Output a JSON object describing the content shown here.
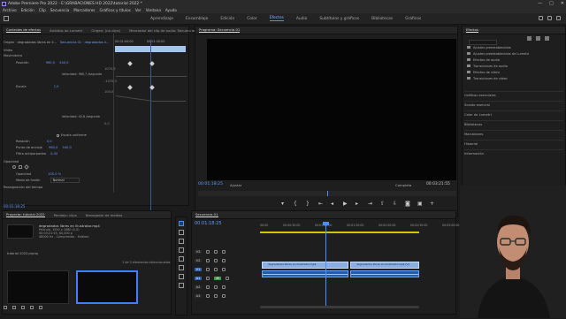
{
  "app": {
    "title": "Adobe Premiere Pro 2022 - E:\\GRABACIONES HD 2022\\tutorial 2022 *",
    "window_controls": [
      "—",
      "□",
      "✕"
    ]
  },
  "menu": [
    "Archivo",
    "Edición",
    "Clip",
    "Secuencia",
    "Marcadores",
    "Gráficos y títulos",
    "Ver",
    "Ventana",
    "Ayuda"
  ],
  "workspace": {
    "tabs": [
      "Aprendizaje",
      "Ensamblaje",
      "Edición",
      "Color",
      "Efectos",
      "Audio",
      "Subtítulos y gráficos",
      "Bibliotecas",
      "Gráficos"
    ],
    "active": "Efectos"
  },
  "effect_controls": {
    "tabs": [
      "Controles de efectos",
      "Ámbitos de Lumetri",
      "Origen: (no clips)",
      "Mezclador del clip de audio: Secuencia"
    ],
    "source": "Origen · degradados libres en il...",
    "sequence": "Secuencia 01 · degradados li...",
    "ruler_start": "00:01:00:00",
    "ruler_mid": "00:01:30:00",
    "section_video": "Vídeo",
    "props": {
      "movimiento": "Movimiento",
      "posicion_label": "Posición",
      "posicion_x": "960,0",
      "posicion_y": "540,0",
      "vel1_label": "Velocidad: 960,7 /segundo",
      "escala_label": "Escala",
      "escala_val": "1,0",
      "vel2_label": "Velocidad: 42,8 /segundo",
      "escala_uniforme": "Escala uniforme",
      "rotacion_label": "Rotación",
      "rotacion_val": "0,0",
      "anclaje_label": "Punto de anclaje",
      "anclaje_x": "960,0",
      "anclaje_y": "540,0",
      "antiparpadeo_label": "Filtro antiparpadeo",
      "antiparpadeo_val": "0,00",
      "opacidad": "Opacidad",
      "opacidad_label": "Opacidad",
      "opacidad_val": "100,0 %",
      "fusion_label": "Modo de fusión",
      "fusion_val": "Normal",
      "reasignacion": "Reasignación del tiempo",
      "graph_top": "100,0",
      "graph_bottom": "0,0",
      "graph_v1": "1070,3",
      "graph_v2": "-1070,3"
    },
    "timecode": "00:01:18:25"
  },
  "program": {
    "tab": "Programa: Secuencia 01",
    "timecode": "00:01:18:25",
    "fit": "Ajustar",
    "resolution": "Completa",
    "duration": "00:03:21:55",
    "controls": [
      "marker",
      "in",
      "out",
      "go-in",
      "step-back",
      "play",
      "step-fwd",
      "go-out",
      "insert",
      "overwrite",
      "export-frame",
      "compare",
      "add"
    ]
  },
  "effects_panel": {
    "tab": "Efectos",
    "folders": [
      "Ajustes preestablecidos",
      "Ajustes preestablecidos de Lumetri",
      "Efectos de audio",
      "Transiciones de audio",
      "Efectos de vídeo",
      "Transiciones de vídeo"
    ],
    "sections": [
      "Gráficos esenciales",
      "Sonido esencial",
      "Color de Lumetri",
      "Bibliotecas",
      "Marcadores",
      "Historial",
      "Información"
    ]
  },
  "project": {
    "tabs": [
      "Proyecto: tutorial 2022",
      "Pendejo: clips",
      "Navegador de medios"
    ],
    "clip_name": "degradados libres en illustrator.mp4",
    "meta1": "Película, 1920 x 1080 (1,0)",
    "meta2": "00:03:21:55, 60,000 p",
    "meta3": "48000 Hz - Comprimido - Estéreo",
    "file": "tutorial 2022.prproj",
    "selection": "1 de 3 elementos seleccionados"
  },
  "timeline": {
    "tab": "Secuencia 01",
    "timecode": "00:01:18:25",
    "ticks": [
      "00:00",
      "00:00:30:00",
      "00:01:00:00",
      "00:01:30:00",
      "00:02:00:00",
      "00:02:30:00",
      "00:03:00:00"
    ],
    "tracks": [
      "V3",
      "V2",
      "V1",
      "A1",
      "A2",
      "A3"
    ],
    "clip1": "degradados libres en illustrator.mp4",
    "clip2": "degradados libres en illustrator.mp4 [V]"
  }
}
